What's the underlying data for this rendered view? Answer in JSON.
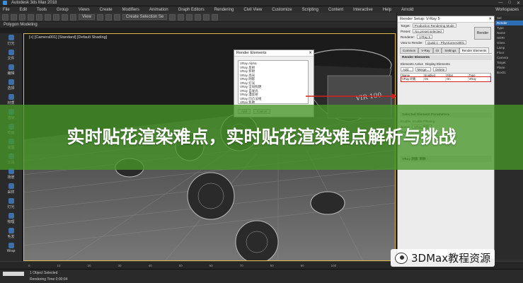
{
  "window": {
    "title": "Autodesk 3ds Max 2018",
    "controls": [
      "—",
      "□",
      "✕"
    ]
  },
  "menubar": {
    "items": [
      "File",
      "Edit",
      "Tools",
      "Group",
      "Views",
      "Create",
      "Modifiers",
      "Animation",
      "Graph Editors",
      "Rendering",
      "Civil View",
      "Customize",
      "Scripting",
      "Content",
      "Interactive",
      "Help",
      "Arnold"
    ],
    "workspaces_label": "Workspaces"
  },
  "toolbar": {
    "view_dropdown": "View",
    "selection_set": "Create Selection Se"
  },
  "ribbon": {
    "label": "Polygon Modeling"
  },
  "leftbar": {
    "items": [
      "灯光",
      "文件",
      "编辑",
      "选择",
      "材质",
      "渲染",
      "动画",
      "视图",
      "工具",
      "场景",
      "采样",
      "灯光",
      "物理",
      "毛发",
      "Wrap"
    ]
  },
  "viewport": {
    "label": "[+] [Camera001] [Standard] [Default Shading]"
  },
  "render_elements": {
    "title": "Render Elements",
    "close": "✕",
    "list": [
      "VRay Alpha",
      "VRay 反射",
      "VRay 折射",
      "VRay 高光",
      "VRay 阴影",
      "VRay 灯光",
      "VRay 全局照明",
      "VRay 自发光",
      "VRay 漫反射",
      "VRay 凹凸法线",
      "VRay 焦散",
      "VRay 物体ID"
    ],
    "buttons": [
      "Add",
      "Cancel"
    ]
  },
  "render_setup": {
    "title": "Render Setup: V-Ray 5",
    "close": "✕",
    "target_label": "Target:",
    "target_value": "Production Rendering Mode",
    "preset_label": "Preset:",
    "preset_value": "No preset selected",
    "renderer_label": "Renderer:",
    "renderer_value": "V-Ray 5",
    "view_label": "View to Render:",
    "view_value": "Quad 4 - PhysCamera001",
    "render_button": "Render",
    "tabs": [
      "Common",
      "V-Ray",
      "GI",
      "Settings",
      "Render Elements"
    ],
    "active_tab": "Render Elements",
    "section_render_elements": "Render Elements",
    "elements_active": "Elements Active",
    "display_elements": "Display Elements",
    "add_button": "Add...",
    "merge_button": "Merge...",
    "delete_button": "Delete",
    "table_headers": [
      "Name",
      "Enabled",
      "Filter",
      "Type"
    ],
    "table_row": [
      "VRay 阴影",
      "On",
      "On",
      "VRay"
    ],
    "selected_element_params": "Selected Element Parameters",
    "enable_label": "Enable",
    "enable_filtering": "Enable Filtering",
    "name_label": "Name:",
    "name_value": "VRay 阴影",
    "output_label": "Output to Combustion™",
    "create_combustion": "Create Combustion Workspace Now",
    "vray_params_section": "VRay 阴影 参数"
  },
  "outliner": {
    "items": [
      "Sel",
      "Render",
      "Type",
      "Name",
      "HDRI",
      "Glass",
      "Lamp",
      "Floor",
      "Camera",
      "Target",
      "Plane",
      "Box01"
    ]
  },
  "banner": {
    "headline": "实时贴花渲染难点，实时贴花渲染难点解析与挑战"
  },
  "timeline": {
    "ticks": [
      "0",
      "10",
      "20",
      "30",
      "40",
      "50",
      "60",
      "70",
      "80",
      "90",
      "100"
    ]
  },
  "statusbar": {
    "selection": "1 Object Selected",
    "render_time": "Rendering Time 0:00:04"
  },
  "watermark": {
    "text": "3DMax教程资源"
  }
}
